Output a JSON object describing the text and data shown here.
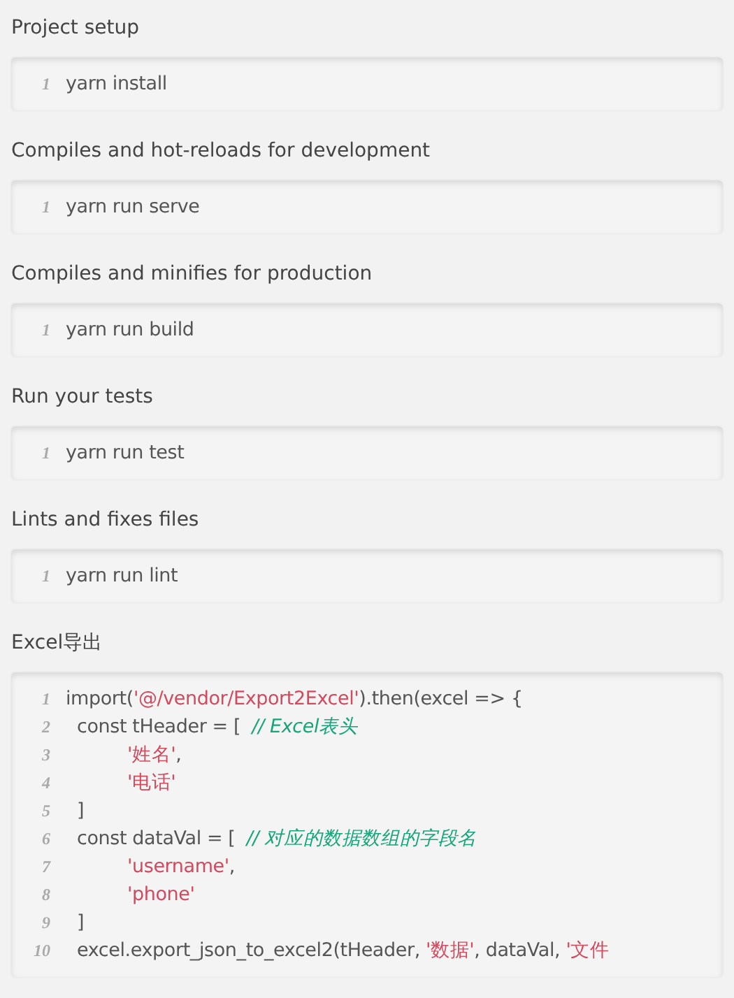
{
  "sections": [
    {
      "title": "Project setup",
      "code": [
        {
          "number": "1",
          "tokens": [
            {
              "kind": "plain",
              "text": "yarn install"
            }
          ]
        }
      ]
    },
    {
      "title": "Compiles and hot-reloads for development",
      "code": [
        {
          "number": "1",
          "tokens": [
            {
              "kind": "plain",
              "text": "yarn run serve"
            }
          ]
        }
      ]
    },
    {
      "title": "Compiles and minifies for production",
      "code": [
        {
          "number": "1",
          "tokens": [
            {
              "kind": "plain",
              "text": "yarn run build"
            }
          ]
        }
      ]
    },
    {
      "title": "Run your tests",
      "code": [
        {
          "number": "1",
          "tokens": [
            {
              "kind": "plain",
              "text": "yarn run test"
            }
          ]
        }
      ]
    },
    {
      "title": "Lints and fixes files",
      "code": [
        {
          "number": "1",
          "tokens": [
            {
              "kind": "plain",
              "text": "yarn run lint"
            }
          ]
        }
      ]
    },
    {
      "title": "Excel导出",
      "code": [
        {
          "number": "1",
          "tokens": [
            {
              "kind": "plain",
              "text": "import("
            },
            {
              "kind": "string",
              "text": "'@/vendor/Export2Excel'"
            },
            {
              "kind": "plain",
              "text": ").then(excel => {"
            }
          ],
          "children": [
            {
              "number": "2",
              "tokens": [
                {
                  "kind": "plain",
                  "text": "const tHeader = [  "
                },
                {
                  "kind": "comment",
                  "text": "// Excel表头"
                }
              ],
              "children": [
                {
                  "number": "3",
                  "tokens": [
                    {
                      "kind": "string",
                      "text": "'姓名'"
                    },
                    {
                      "kind": "plain",
                      "text": ","
                    }
                  ]
                },
                {
                  "number": "4",
                  "tokens": [
                    {
                      "kind": "string",
                      "text": "'电话'"
                    }
                  ]
                }
              ]
            },
            {
              "number": "5",
              "tokens": [
                {
                  "kind": "plain",
                  "text": "]"
                }
              ]
            },
            {
              "number": "6",
              "tokens": [
                {
                  "kind": "plain",
                  "text": "const dataVal = [  "
                },
                {
                  "kind": "comment",
                  "text": "// 对应的数据数组的字段名"
                }
              ],
              "children": [
                {
                  "number": "7",
                  "tokens": [
                    {
                      "kind": "string",
                      "text": "'username'"
                    },
                    {
                      "kind": "plain",
                      "text": ","
                    }
                  ]
                },
                {
                  "number": "8",
                  "tokens": [
                    {
                      "kind": "string",
                      "text": "'phone'"
                    }
                  ]
                }
              ]
            },
            {
              "number": "9",
              "tokens": [
                {
                  "kind": "plain",
                  "text": "]"
                }
              ]
            },
            {
              "number": "10",
              "tokens": [
                {
                  "kind": "plain",
                  "text": "excel.export_json_to_excel2(tHeader, "
                },
                {
                  "kind": "string",
                  "text": "'数据'"
                },
                {
                  "kind": "plain",
                  "text": ", dataVal, "
                },
                {
                  "kind": "string",
                  "text": "'文件"
                }
              ]
            }
          ]
        }
      ]
    }
  ]
}
